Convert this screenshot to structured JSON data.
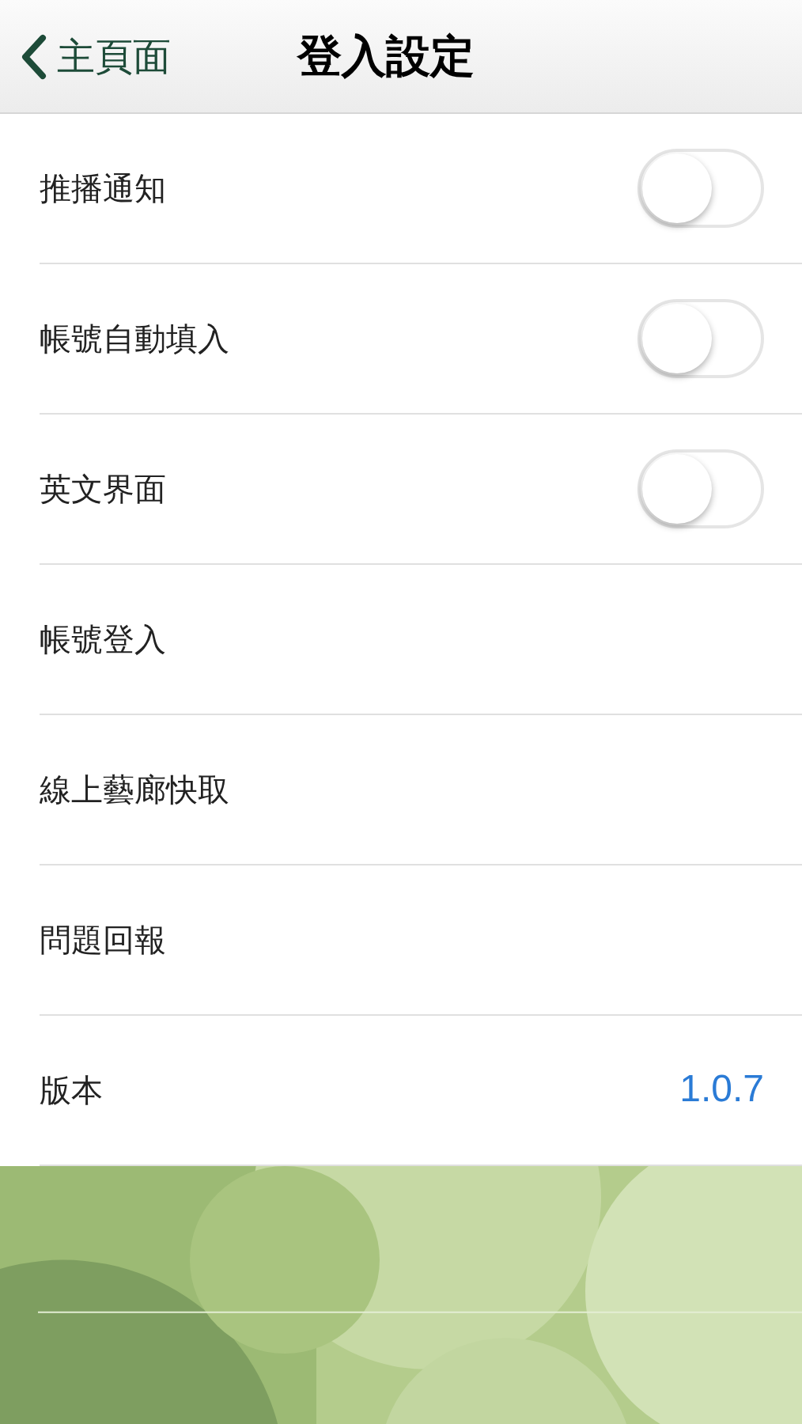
{
  "nav": {
    "back": "主頁面",
    "title": "登入設定"
  },
  "rows": [
    {
      "kind": "toggle",
      "label": "推播通知",
      "on": false
    },
    {
      "kind": "toggle",
      "label": "帳號自動填入",
      "on": false
    },
    {
      "kind": "toggle",
      "label": "英文界面",
      "on": false
    },
    {
      "kind": "link",
      "label": "帳號登入"
    },
    {
      "kind": "link",
      "label": "線上藝廊快取"
    },
    {
      "kind": "link",
      "label": "問題回報"
    },
    {
      "kind": "value",
      "label": "版本",
      "value": "1.0.7"
    }
  ]
}
